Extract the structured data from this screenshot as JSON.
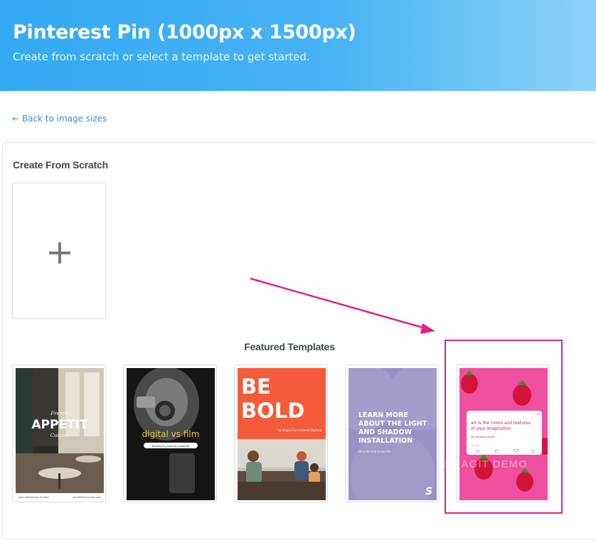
{
  "header": {
    "title": "Pinterest Pin (1000px x 1500px)",
    "subtitle": "Create from scratch or select a template to get started."
  },
  "nav": {
    "back_label": "← Back to image sizes"
  },
  "scratch": {
    "title": "Create From Scratch",
    "plus_icon": "plus-icon"
  },
  "featured": {
    "title": "Featured Templates",
    "templates": [
      {
        "name": "appetit",
        "text_small_top": "French",
        "text_main": "APPÉTIT",
        "text_small_bottom": "Cuisine",
        "footer_left": "open Wednesday-Sunday",
        "footer_right": "appetitfrenchresto.com"
      },
      {
        "name": "digital-vs-film",
        "text_main": "digital vs film",
        "text_pill": "finding my favorite medium"
      },
      {
        "name": "be-bold",
        "text_line1": "BE",
        "text_line2": "BOLD",
        "text_small": "Synergize Recruitment Agency"
      },
      {
        "name": "light-shadow",
        "text_main": "LEARN MORE ABOUT THE LIGHT AND SHADOW INSTALLATION",
        "text_small": "click the link in our bio",
        "logo": "S"
      },
      {
        "name": "strawberries",
        "text_main": "art is the colors and textures of your imagination",
        "text_handle": "@charming.christa",
        "text_small": "12 min"
      }
    ]
  },
  "colors": {
    "accent_magenta": "#e0208a",
    "hero_blue": "#33a9f2"
  },
  "watermark": "SNAGIT DEMO"
}
